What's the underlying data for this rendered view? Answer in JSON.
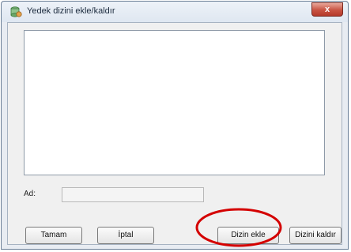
{
  "window": {
    "title": "Yedek dizini ekle/kaldır",
    "close_glyph": "x"
  },
  "form": {
    "name_label": "Ad:",
    "name_value": ""
  },
  "buttons": {
    "ok": "Tamam",
    "cancel": "İptal",
    "add_dir": "Dizin ekle",
    "remove_dir": "Dizini kaldır"
  },
  "annotation": {
    "highlight_color": "#d40000",
    "highlighted_control": "Dizin ekle"
  }
}
